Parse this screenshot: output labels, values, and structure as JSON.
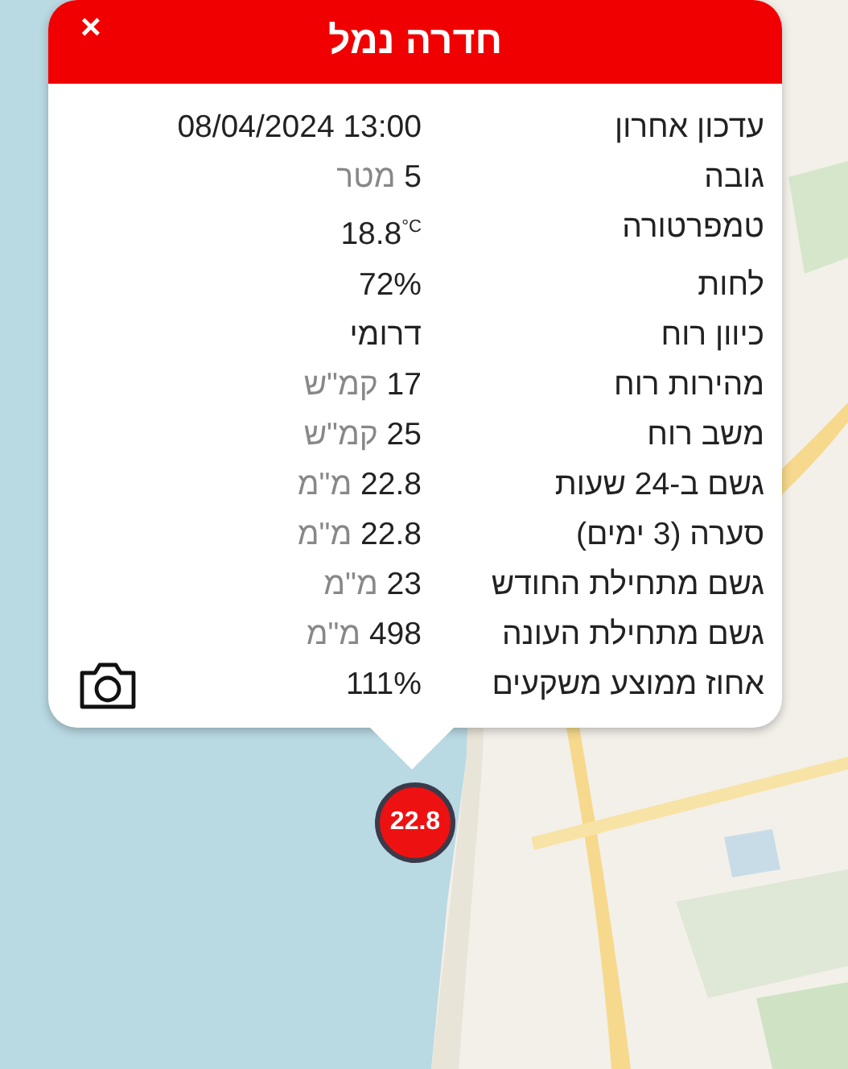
{
  "popup": {
    "title": "חדרה נמל",
    "close": "×",
    "rows": [
      {
        "label": "עדכון אחרון",
        "value": "08/04/2024 13:00"
      },
      {
        "label": "גובה",
        "value": "5",
        "unit": "מטר"
      },
      {
        "label": "טמפרטורה",
        "value": "18.8$^{°C}$"
      },
      {
        "label": "לחות",
        "value": "72%"
      },
      {
        "label": "כיוון רוח",
        "value": "דרומי"
      },
      {
        "label": "מהירות רוח",
        "value": "17",
        "unit": "קמ\"ש"
      },
      {
        "label": "משב רוח",
        "value": "25",
        "unit": "קמ\"ש"
      },
      {
        "label": "גשם ב-24 שעות",
        "value": "22.8",
        "unit": "מ\"מ"
      },
      {
        "label": "סערה (3 ימים)",
        "value": "22.8",
        "unit": "מ\"מ"
      },
      {
        "label": "גשם מתחילת החודש",
        "value": "23",
        "unit": "מ\"מ"
      },
      {
        "label": "גשם מתחילת העונה",
        "value": "498",
        "unit": "מ\"מ"
      },
      {
        "label": "אחוז ממוצע משקעים",
        "value": "111%"
      }
    ]
  },
  "marker": {
    "value": "22.8",
    "color": "#ee1111"
  }
}
